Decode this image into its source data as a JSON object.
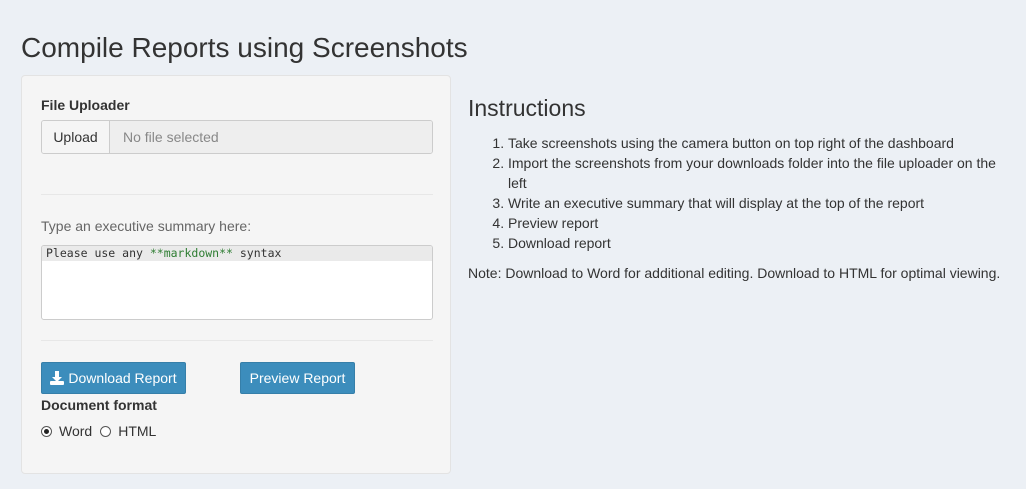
{
  "page": {
    "title": "Compile Reports using Screenshots"
  },
  "sidebar": {
    "file_uploader": {
      "label": "File Uploader",
      "button_label": "Upload",
      "placeholder": "No file selected"
    },
    "summary": {
      "label": "Type an executive summary here:",
      "value_prefix": "Please use any ",
      "value_markdown": "**markdown**",
      "value_suffix": " syntax"
    },
    "buttons": {
      "download_label": "Download Report",
      "preview_label": "Preview Report"
    },
    "document_format": {
      "label": "Document format",
      "options": [
        "Word",
        "HTML"
      ],
      "selected": "Word"
    }
  },
  "main": {
    "instructions_title": "Instructions",
    "steps": [
      "Take screenshots using the camera button on top right of the dashboard",
      "Import the screenshots from your downloads folder into the file uploader on the left",
      "Write an executive summary that will display at the top of the report",
      "Preview report",
      "Download report"
    ],
    "note": "Note: Download to Word for additional editing. Download to HTML for optimal viewing."
  },
  "colors": {
    "background": "#ecf0f5",
    "panel": "#f5f5f5",
    "primary_button": "#3c8dbc",
    "markdown_text": "#2e7d32"
  },
  "icons": {
    "download_button": "download-icon"
  }
}
